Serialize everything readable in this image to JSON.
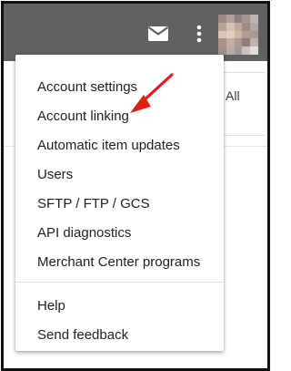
{
  "toolbar": {
    "mail_icon": "mail-icon",
    "more_icon": "more-vert-icon",
    "background_color": "#616161"
  },
  "content": {
    "filter_all_label": "All"
  },
  "menu": {
    "items": [
      {
        "label": "Account settings"
      },
      {
        "label": "Account linking"
      },
      {
        "label": "Automatic item updates"
      },
      {
        "label": "Users"
      },
      {
        "label": "SFTP / FTP / GCS"
      },
      {
        "label": "API diagnostics"
      },
      {
        "label": "Merchant Center programs"
      }
    ],
    "secondary_items": [
      {
        "label": "Help"
      },
      {
        "label": "Send feedback"
      }
    ]
  },
  "annotation": {
    "arrow_color": "#e01b1b",
    "points_to": "Account linking"
  }
}
